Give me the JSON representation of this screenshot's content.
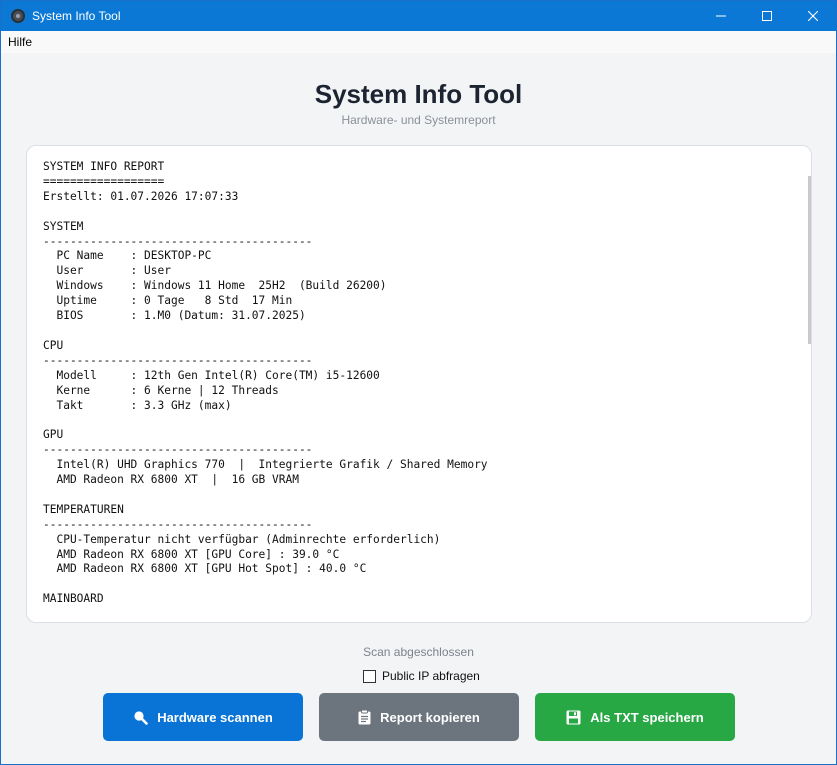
{
  "window": {
    "title": "System Info Tool",
    "minimize_icon": "minimize-icon",
    "maximize_icon": "maximize-icon",
    "close_icon": "close-icon"
  },
  "menubar": {
    "items": [
      "Hilfe"
    ]
  },
  "header": {
    "title": "System Info Tool",
    "subtitle": "Hardware- und Systemreport"
  },
  "report": {
    "lines": [
      "SYSTEM INFO REPORT",
      "==================",
      "Erstellt: 01.07.2026 17:07:33",
      "",
      "SYSTEM",
      "----------------------------------------",
      "  PC Name    : DESKTOP-PC",
      "  User       : User",
      "  Windows    : Windows 11 Home  25H2  (Build 26200)",
      "  Uptime     : 0 Tage   8 Std  17 Min",
      "  BIOS       : 1.M0 (Datum: 31.07.2025)",
      "",
      "CPU",
      "----------------------------------------",
      "  Modell     : 12th Gen Intel(R) Core(TM) i5-12600",
      "  Kerne      : 6 Kerne | 12 Threads",
      "  Takt       : 3.3 GHz (max)",
      "",
      "GPU",
      "----------------------------------------",
      "  Intel(R) UHD Graphics 770  |  Integrierte Grafik / Shared Memory",
      "  AMD Radeon RX 6800 XT  |  16 GB VRAM",
      "",
      "TEMPERATUREN",
      "----------------------------------------",
      "  CPU-Temperatur nicht verfügbar (Adminrechte erforderlich)",
      "  AMD Radeon RX 6800 XT [GPU Core] : 39.0 °C",
      "  AMD Radeon RX 6800 XT [GPU Hot Spot] : 40.0 °C",
      "",
      "MAINBOARD",
      "----------------------------------------"
    ]
  },
  "status": {
    "text": "Scan abgeschlossen"
  },
  "options": {
    "public_ip_label": "Public IP abfragen",
    "public_ip_checked": false
  },
  "buttons": {
    "scan_label": "Hardware scannen",
    "copy_label": "Report kopieren",
    "save_label": "Als TXT speichern"
  },
  "colors": {
    "titlebar": "#0a78d4",
    "scan_button": "#0a74d6",
    "copy_button": "#6c757d",
    "save_button": "#28a745"
  }
}
